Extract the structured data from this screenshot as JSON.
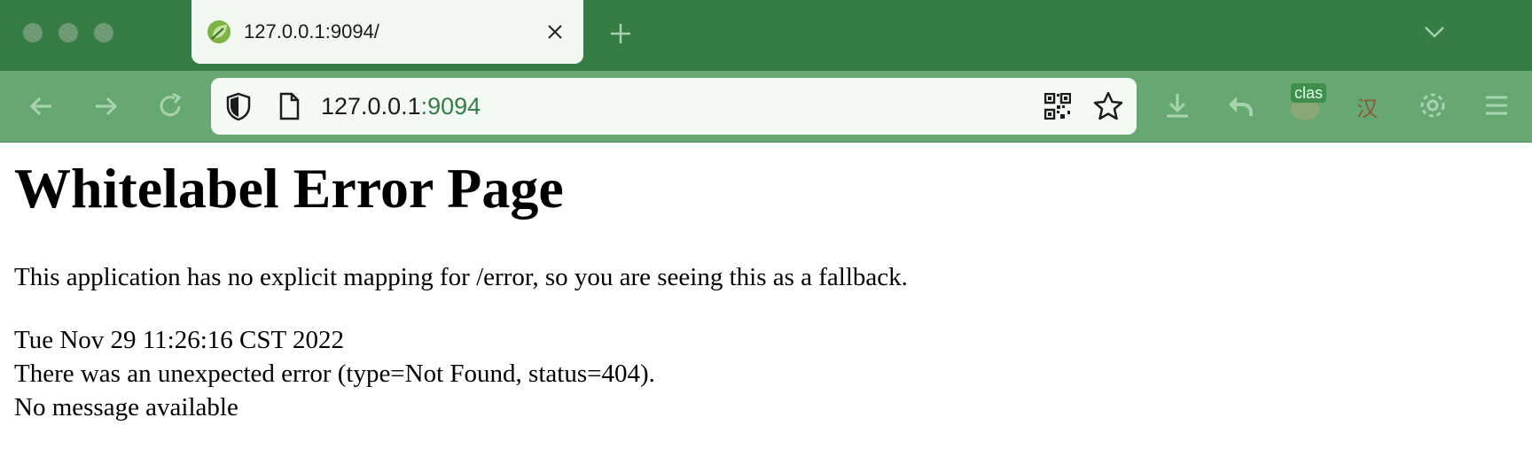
{
  "browser": {
    "tab": {
      "title": "127.0.0.1:9094/"
    },
    "url": {
      "host": "127.0.0.1",
      "port": ":9094"
    },
    "extensions": {
      "badge": "clas",
      "translate_glyph": "汉"
    }
  },
  "page": {
    "heading": "Whitelabel Error Page",
    "description": "This application has no explicit mapping for /error, so you are seeing this as a fallback.",
    "timestamp": "Tue Nov 29 11:26:16 CST 2022",
    "error_line": "There was an unexpected error (type=Not Found, status=404).",
    "message": "No message available"
  },
  "colors": {
    "titlebar": "#367c45",
    "toolbar": "#67a872",
    "accent": "#367c45"
  }
}
